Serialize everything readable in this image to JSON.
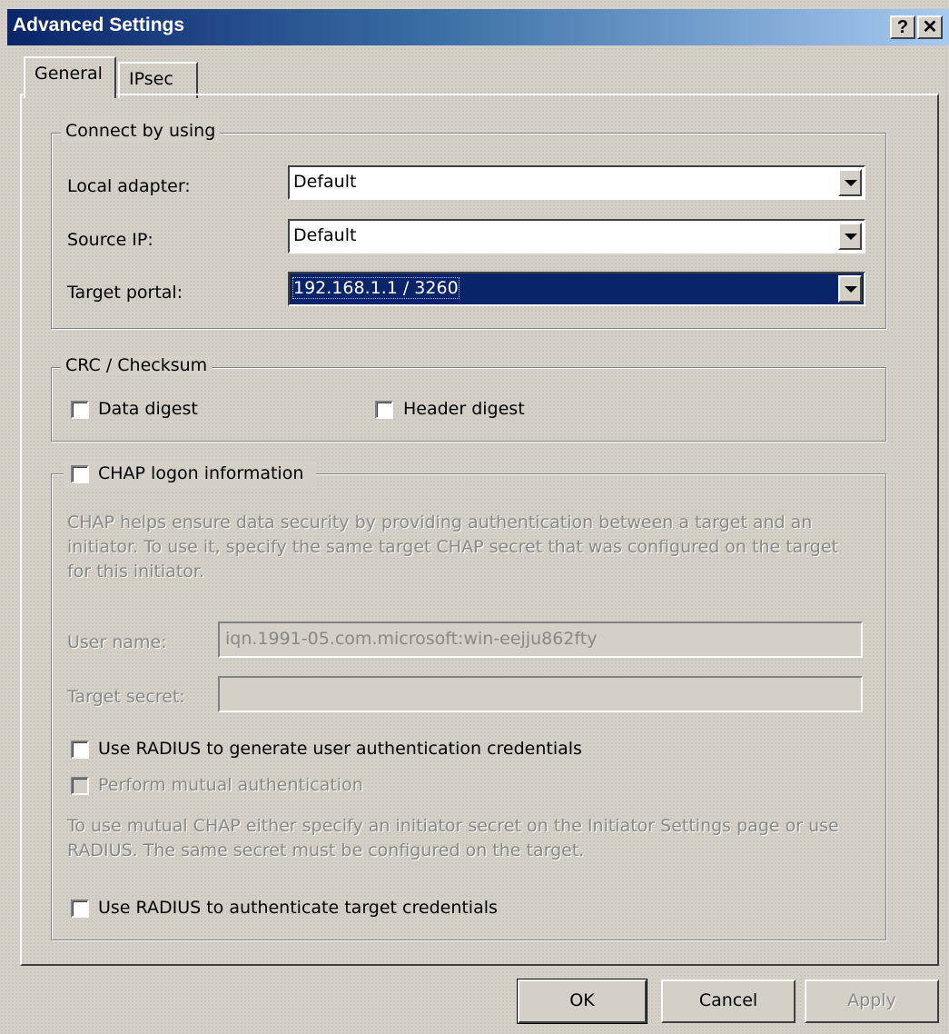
{
  "window": {
    "title": "Advanced Settings",
    "help_label": "?",
    "close_label": "✕"
  },
  "tabs": [
    {
      "label": "General",
      "active": true
    },
    {
      "label": "IPsec",
      "active": false
    }
  ],
  "connect_group": {
    "title": "Connect by using",
    "local_adapter": {
      "label": "Local adapter:",
      "value": "Default"
    },
    "source_ip": {
      "label": "Source IP:",
      "value": "Default"
    },
    "target_portal": {
      "label": "Target portal:",
      "value": "192.168.1.1 / 3260"
    }
  },
  "crc_group": {
    "title": "CRC / Checksum",
    "data_digest": "Data digest",
    "header_digest": "Header digest"
  },
  "chap_group": {
    "title": "CHAP logon information",
    "description": "CHAP helps ensure data security by providing authentication between a target and an initiator. To use it, specify the same target CHAP secret that was configured on the target for this initiator.",
    "user_name_label": "User name:",
    "user_name_value": "iqn.1991-05.com.microsoft:win-eejju862fty",
    "target_secret_label": "Target secret:",
    "target_secret_value": "",
    "radius_generate": "Use RADIUS to generate user authentication credentials",
    "mutual_auth": "Perform mutual authentication",
    "mutual_description": "To use mutual CHAP either specify an initiator secret on the Initiator Settings page or use RADIUS.  The same secret must be configured on the target.",
    "radius_authenticate": "Use RADIUS to authenticate target credentials"
  },
  "buttons": {
    "ok": "OK",
    "cancel": "Cancel",
    "apply": "Apply"
  },
  "colors": {
    "title_start": "#0a246a",
    "title_end": "#a6caf0",
    "selection": "#0a246a",
    "face": "#d4d0c8"
  }
}
